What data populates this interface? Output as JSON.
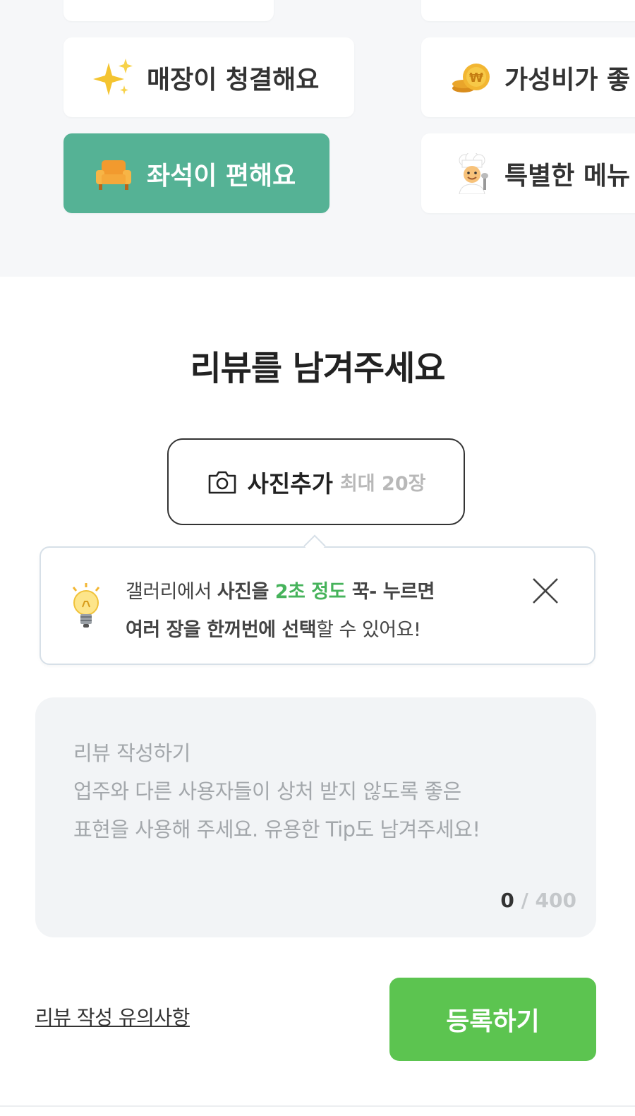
{
  "keyword_chips": [
    {
      "label": "",
      "icon": "none"
    },
    {
      "label": "",
      "icon": "none"
    },
    {
      "label": "매장이 청결해요",
      "icon": "sparkles-icon",
      "selected": false
    },
    {
      "label": "가성비가 좋",
      "icon": "coin-icon",
      "selected": false
    },
    {
      "label": "좌석이 편해요",
      "icon": "armchair-icon",
      "selected": true
    },
    {
      "label": "특별한 메뉴",
      "icon": "chef-icon",
      "selected": false
    }
  ],
  "colors": {
    "selected_chip": "#55b295",
    "submit": "#5cc450",
    "tip_highlight": "#46b35b",
    "top_background": "#f6f7f9",
    "review_box": "#f2f4f6"
  },
  "review": {
    "title": "리뷰를 남겨주세요",
    "photo_button": {
      "label": "사진추가",
      "limit": "최대 20장",
      "icon": "camera-icon"
    },
    "tip": {
      "icon": "lightbulb-icon",
      "part1": "갤러리에서 ",
      "part2": "사진을 ",
      "part3": "2초 정도",
      "part4": " 꾹- 누르면",
      "part5": "여러 장을 한꺼번에 선택",
      "part6": "할 수 있어요!",
      "close_icon": "close-icon"
    },
    "placeholder": "리뷰 작성하기\n업주와 다른 사용자들이 상처 받지 않도록 좋은\n표현을 사용해 주세요. 유용한 Tip도 남겨주세요!",
    "counter_current": "0",
    "counter_max": " / 400"
  },
  "footer": {
    "guide_link": "리뷰 작성 유의사항",
    "submit_label": "등록하기"
  }
}
